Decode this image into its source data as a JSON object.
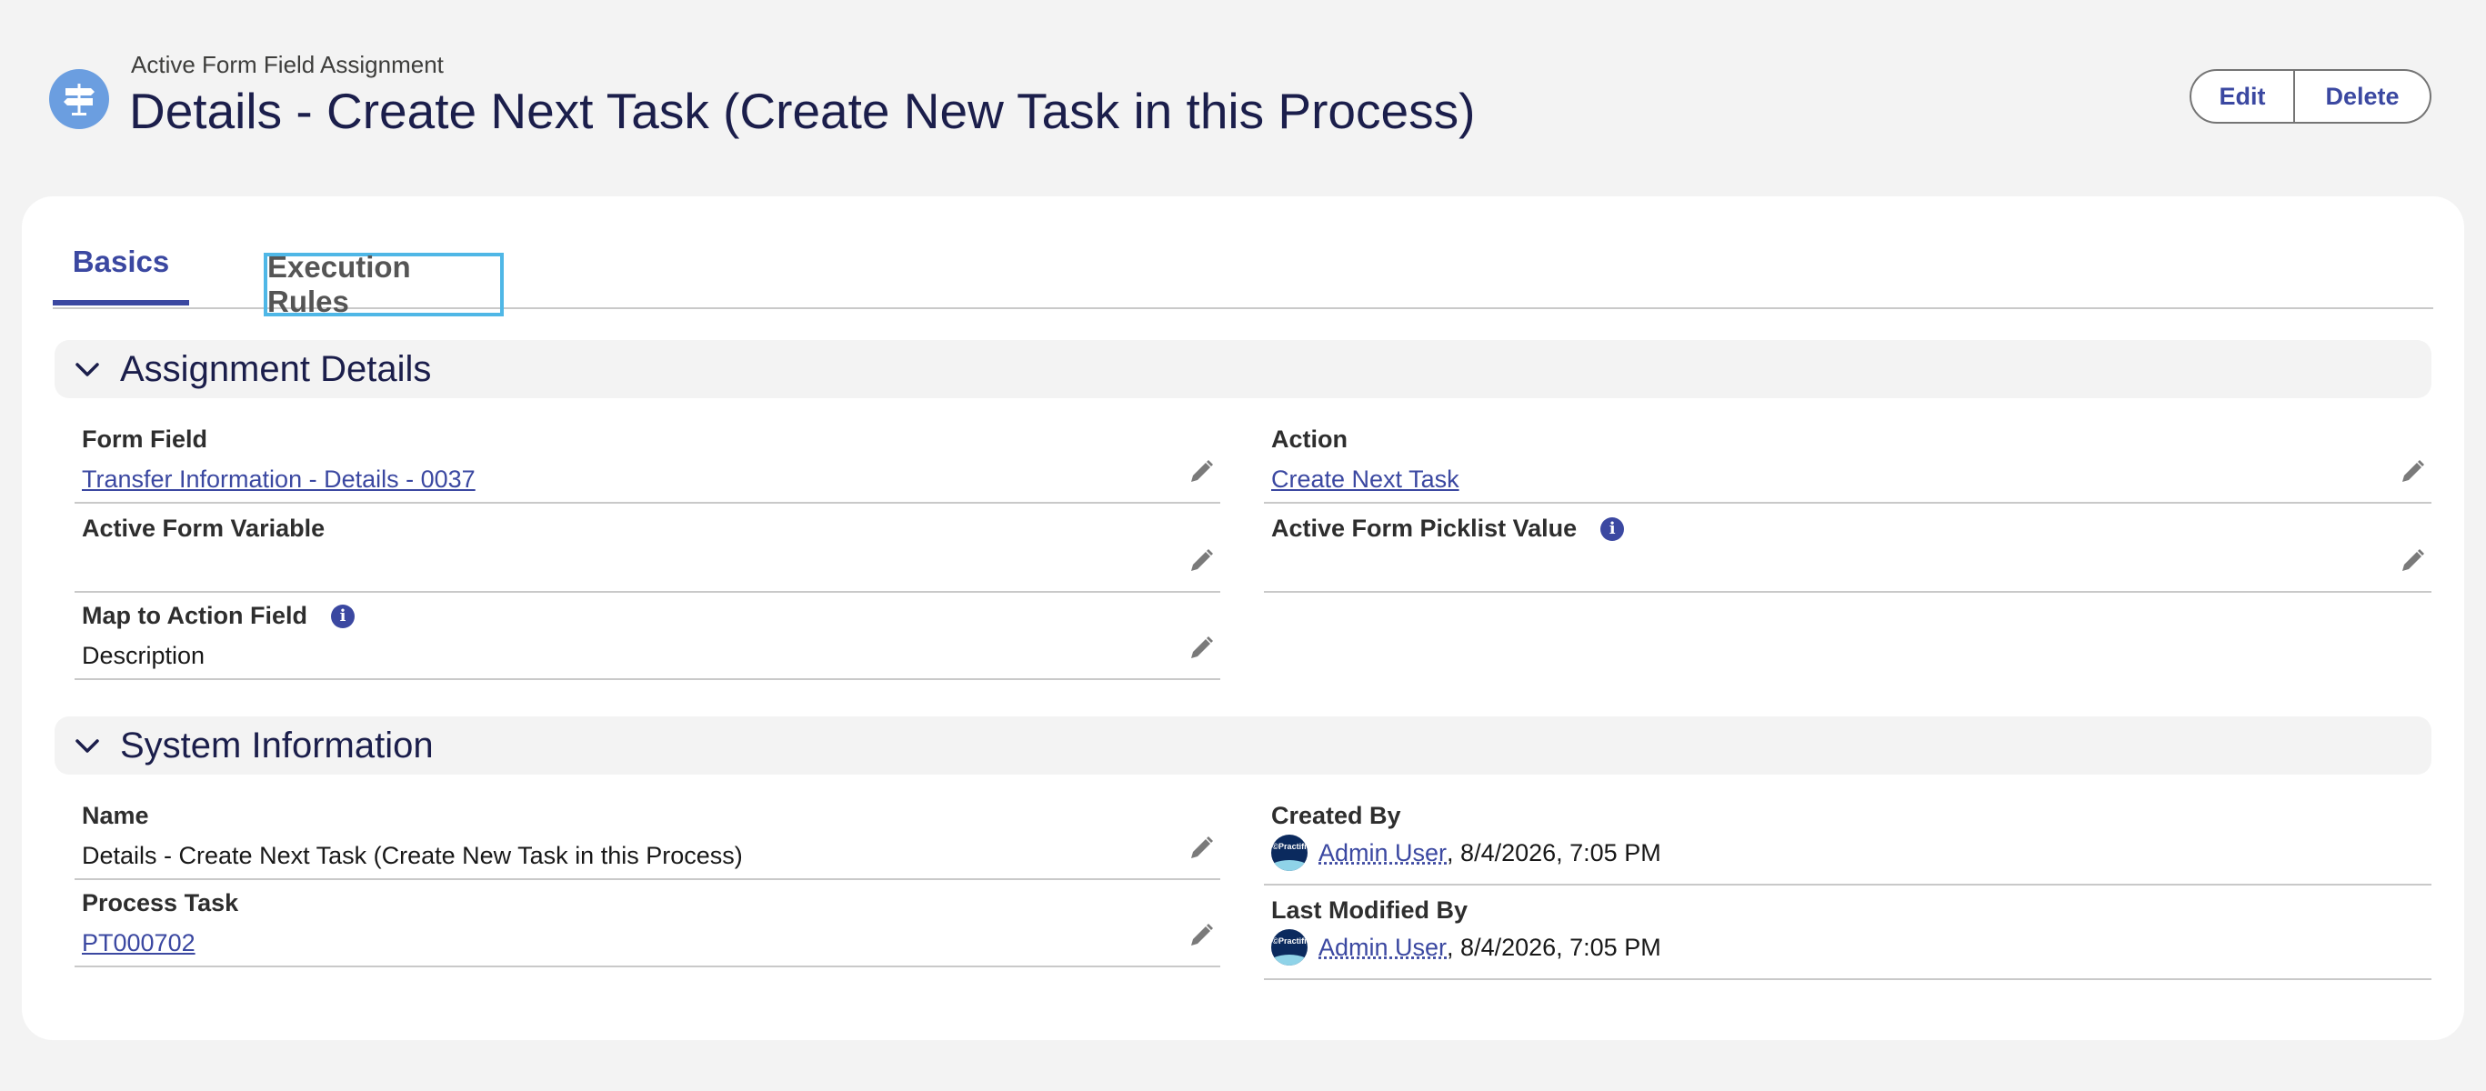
{
  "header": {
    "object_type": "Active Form Field Assignment",
    "title": "Details - Create Next Task (Create New Task in this Process)",
    "icon": "signpost-icon",
    "edit_label": "Edit",
    "delete_label": "Delete"
  },
  "tabs": {
    "basics": "Basics",
    "execution_rules": "Execution Rules"
  },
  "assignment_details": {
    "title": "Assignment Details",
    "form_field": {
      "label": "Form Field",
      "value": "Transfer Information - Details - 0037"
    },
    "action": {
      "label": "Action",
      "value": "Create Next Task"
    },
    "active_form_variable": {
      "label": "Active Form Variable",
      "value": ""
    },
    "active_form_picklist_value": {
      "label": "Active Form Picklist Value",
      "value": ""
    },
    "map_to_action_field": {
      "label": "Map to Action Field",
      "value": "Description"
    }
  },
  "system_information": {
    "title": "System Information",
    "name": {
      "label": "Name",
      "value": "Details - Create Next Task (Create New Task in this Process)"
    },
    "process_task": {
      "label": "Process Task",
      "value": "PT000702"
    },
    "created_by": {
      "label": "Created By",
      "user": "Admin User",
      "date": ", 8/4/2026, 7:05 PM"
    },
    "last_modified_by": {
      "label": "Last Modified By",
      "user": "Admin User",
      "date": ", 8/4/2026, 7:05 PM"
    },
    "avatar_text": "©Practifi"
  },
  "colors": {
    "accent": "#3b48a1",
    "focus_outline": "#4fb7e6",
    "icon_bg": "#6b9ee0",
    "title": "#1b1e4b"
  }
}
